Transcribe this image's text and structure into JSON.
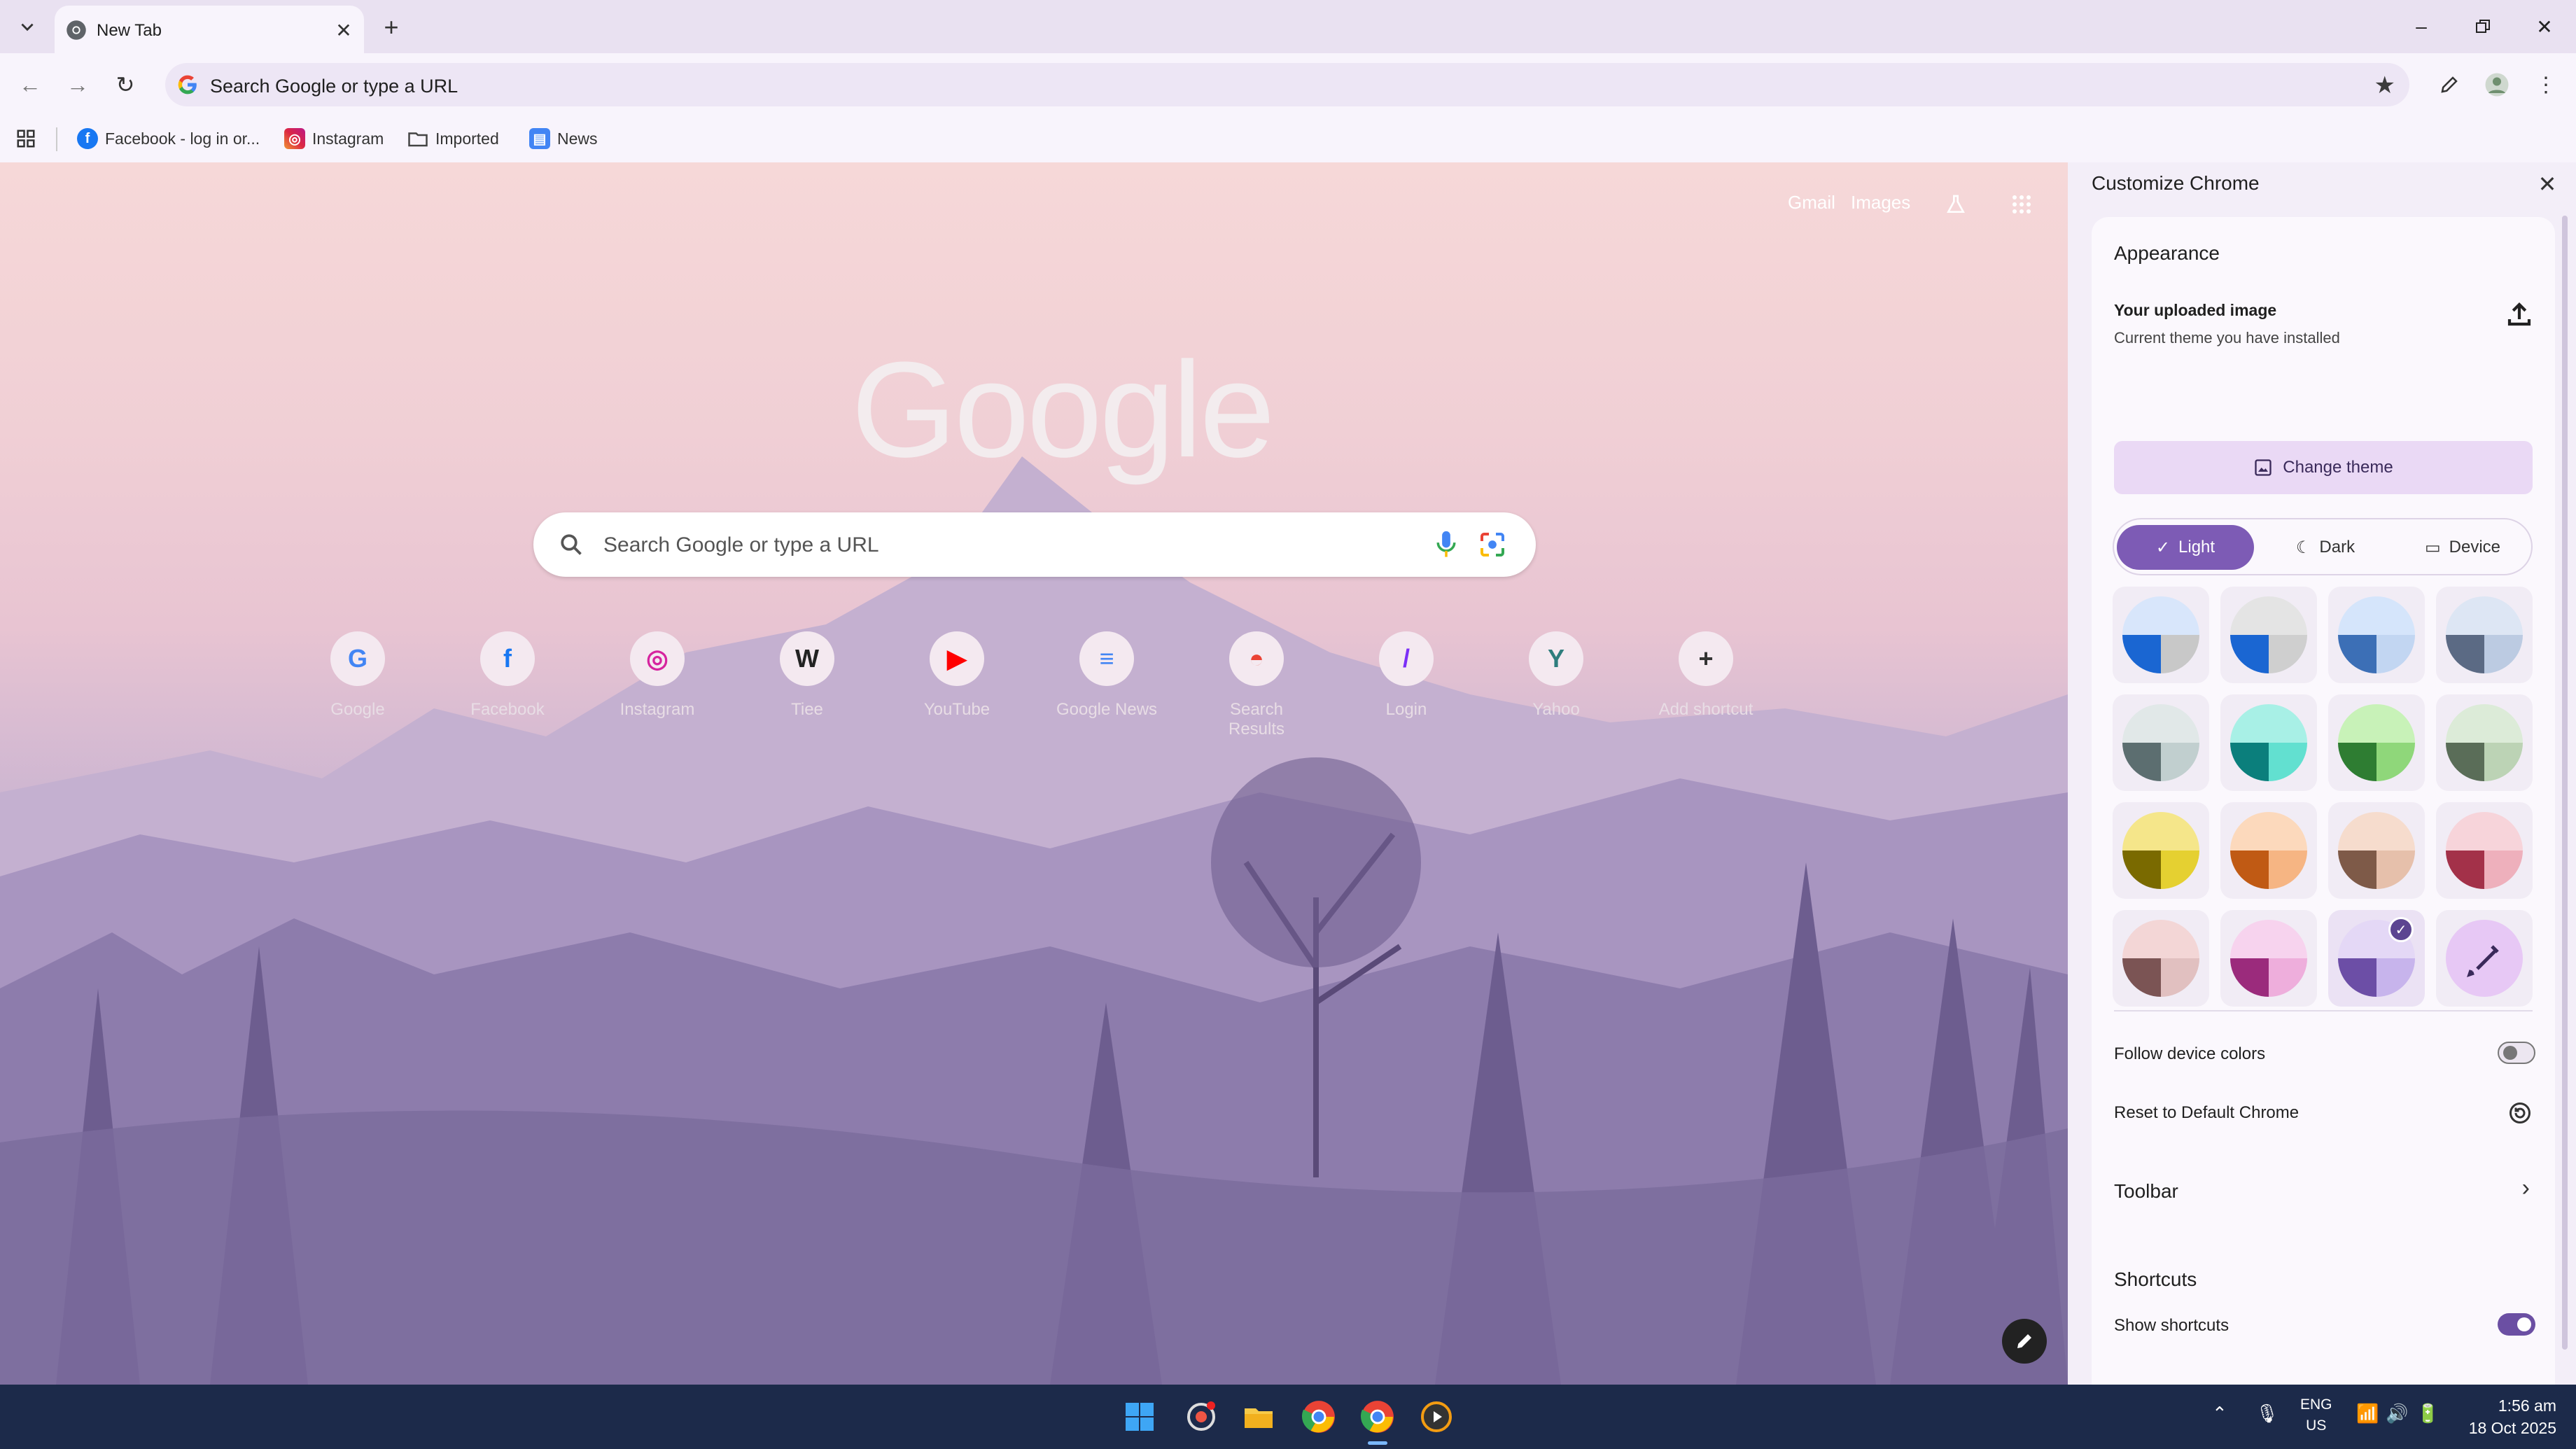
{
  "browser": {
    "tab": {
      "title": "New Tab"
    },
    "omnibox": {
      "placeholder": "Search Google or type a URL"
    },
    "bookmarks": [
      {
        "label": "Facebook - log in or...",
        "icon": "facebook-icon"
      },
      {
        "label": "Instagram",
        "icon": "instagram-icon"
      },
      {
        "label": "Imported",
        "icon": "folder-icon"
      },
      {
        "label": "News",
        "icon": "news-icon"
      }
    ]
  },
  "ntp": {
    "links": {
      "gmail": "Gmail",
      "images": "Images"
    },
    "logo": "Google",
    "search_placeholder": "Search Google or type a URL",
    "shortcuts": [
      {
        "label": "Google",
        "icon": "google-icon",
        "glyph": "G",
        "color": "#4285f4"
      },
      {
        "label": "Facebook",
        "icon": "facebook-icon",
        "glyph": "f",
        "color": "#1877f2"
      },
      {
        "label": "Instagram",
        "icon": "instagram-icon",
        "glyph": "◎",
        "color": "#d6249f"
      },
      {
        "label": "Tiee",
        "icon": "wikipedia-icon",
        "glyph": "W",
        "color": "#222222"
      },
      {
        "label": "YouTube",
        "icon": "youtube-icon",
        "glyph": "▶",
        "color": "#ff0000"
      },
      {
        "label": "Google News",
        "icon": "google-news-icon",
        "glyph": "≡",
        "color": "#4285f4"
      },
      {
        "label": "Search Results",
        "icon": "search-results-icon",
        "glyph": "◓",
        "color": "#ea4335"
      },
      {
        "label": "Login",
        "icon": "login-icon",
        "glyph": "/",
        "color": "#7b2ff7"
      },
      {
        "label": "Yahoo",
        "icon": "yahoo-icon",
        "glyph": "Y",
        "color": "#2e7d7d"
      },
      {
        "label": "Add shortcut",
        "icon": "plus-icon",
        "glyph": "+",
        "color": "#333333"
      }
    ]
  },
  "panel": {
    "title": "Customize Chrome",
    "appearance": {
      "heading": "Appearance",
      "uploaded_title": "Your uploaded image",
      "uploaded_subtitle": "Current theme you have installed",
      "change_theme": "Change theme",
      "modes": {
        "light": "Light",
        "dark": "Dark",
        "device": "Device"
      },
      "selected_mode": "Light",
      "swatches": [
        {
          "top": "#d8e6fb",
          "left": "#1a66d2",
          "right": "#c8c8c8"
        },
        {
          "top": "#e4e4e4",
          "left": "#1a66d2",
          "right": "#cfcfcf"
        },
        {
          "top": "#d5e5fb",
          "left": "#3c6fb6",
          "right": "#c2d6f2"
        },
        {
          "top": "#dde6f4",
          "left": "#5b6a84",
          "right": "#bccbe2"
        },
        {
          "top": "#e1e8e8",
          "left": "#5c6e70",
          "right": "#c1cfcf"
        },
        {
          "top": "#a8f0e6",
          "left": "#0b7f7c",
          "right": "#62e0d0"
        },
        {
          "top": "#c8f2b8",
          "left": "#2e7d32",
          "right": "#8fd77a"
        },
        {
          "top": "#dcebd8",
          "left": "#5a6d58",
          "right": "#bcd3b5"
        },
        {
          "top": "#f5e68a",
          "left": "#7a6a00",
          "right": "#e5d031"
        },
        {
          "top": "#fcd9bc",
          "left": "#c05a14",
          "right": "#f6b583"
        },
        {
          "top": "#f6dccd",
          "left": "#7e5a48",
          "right": "#e6c0ab"
        },
        {
          "top": "#f7d4da",
          "left": "#a33149",
          "right": "#eeb0bc"
        },
        {
          "top": "#f3d6d6",
          "left": "#7b5454",
          "right": "#e1c0c0"
        },
        {
          "top": "#f7d3ee",
          "left": "#9b2b7c",
          "right": "#eeaedc"
        },
        {
          "top": "#e4d8f6",
          "left": "#6c4ea6",
          "right": "#c7b4ec"
        },
        {
          "top": "#e7c8f5",
          "left": "#e7c8f5",
          "right": "#e7c8f5",
          "custom": true
        }
      ],
      "selected_swatch": 14,
      "follow_device_colors": "Follow device colors",
      "follow_device_on": false,
      "reset": "Reset to Default Chrome"
    },
    "toolbar": {
      "heading": "Toolbar"
    },
    "shortcuts": {
      "heading": "Shortcuts",
      "show_shortcuts": "Show shortcuts",
      "show_on": true
    }
  },
  "taskbar": {
    "language": "ENG",
    "region": "US",
    "time": "1:56 am",
    "date": "18 Oct 2025",
    "apps": [
      "windows-start-icon",
      "screen-recorder-icon",
      "file-explorer-icon",
      "chrome-icon",
      "chrome-active-icon",
      "media-player-icon"
    ]
  },
  "colors": {
    "accent": "#7d5bb5",
    "panel_bg": "#f3eef8",
    "taskbar_bg": "#1c2a4a"
  }
}
